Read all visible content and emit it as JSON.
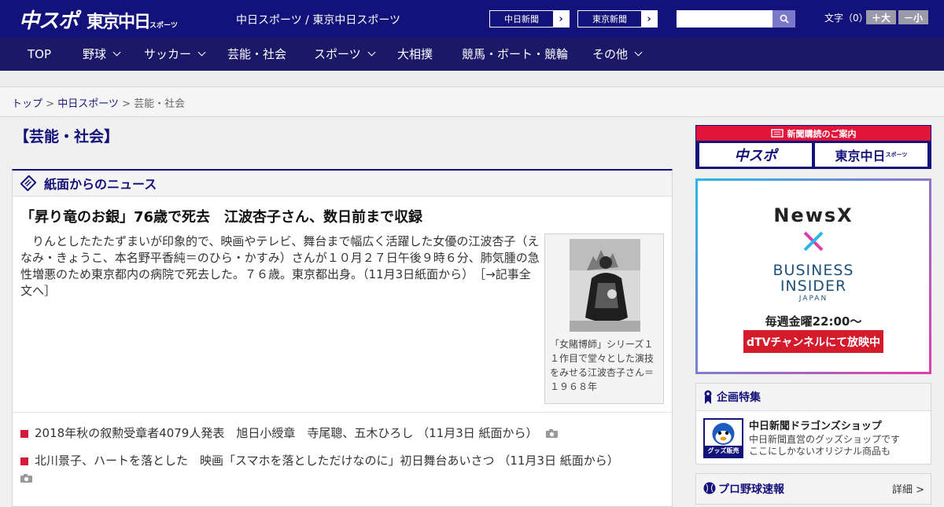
{
  "header": {
    "logo_main": "中スポ",
    "logo_sub": "東京中日",
    "logo_sub_small": "スポーツ",
    "site_links": "中日スポーツ / 東京中日スポーツ",
    "ext_links": [
      "中日新聞",
      "東京新聞"
    ],
    "search_placeholder": "",
    "font_label": "文字（0）",
    "font_larger": "＋大",
    "font_smaller": "－小"
  },
  "nav": {
    "items": [
      {
        "label": "TOP",
        "dropdown": false
      },
      {
        "label": "野球",
        "dropdown": true
      },
      {
        "label": "サッカー",
        "dropdown": true
      },
      {
        "label": "芸能・社会",
        "dropdown": false
      },
      {
        "label": "スポーツ",
        "dropdown": true
      },
      {
        "label": "大相撲",
        "dropdown": false
      },
      {
        "label": "競馬・ボート・競輪",
        "dropdown": false
      },
      {
        "label": "その他",
        "dropdown": true
      }
    ]
  },
  "breadcrumb": {
    "items": [
      "トップ",
      "中日スポーツ",
      "芸能・社会"
    ],
    "separator": " > "
  },
  "page_title": "【芸能・社会】",
  "main": {
    "section_title": "紙面からのニュース",
    "top_story": {
      "headline": "「昇り竜のお銀」76歳で死去　江波杏子さん、数日前まで収録",
      "lead": "　りんとしたたたずまいが印象的で、映画やテレビ、舞台まで幅広く活躍した女優の江波杏子（えなみ・きょうこ、本名野平香純＝のひら・かすみ）さんが１０月２７日午後９時６分、肺気腫の急性増悪のため東京都内の病院で死去した。７６歳。東京都出身。（11月3日紙面から）",
      "more_link": "［→記事全文へ］",
      "photo_caption": "「女賭博師」シリーズ１１作目で堂々とした演技をみせる江波杏子さん＝１９６８年"
    },
    "news_list": [
      {
        "text": "2018年秋の叙勲受章者4079人発表　旭日小綬章　寺尾聰、五木ひろし",
        "date": "（11月3日 紙面から）",
        "has_photo": true
      },
      {
        "text": "北川景子、ハートを落とした　映画「スマホを落としただけなのに」初日舞台あいさつ",
        "date": "（11月3日 紙面から）",
        "has_photo": true
      }
    ]
  },
  "sidebar": {
    "subscribe": {
      "heading": "新聞購読のご案内",
      "logo_left": "中スポ",
      "logo_right": "東京中日",
      "logo_right_small": "スポーツ"
    },
    "ad": {
      "brand": "NewsX",
      "name_line1": "BUSINESS",
      "name_line2": "INSIDER",
      "country": "JAPAN",
      "schedule": "毎週金曜22:00〜",
      "cta": "dTVチャンネルにて放映中"
    },
    "feature": {
      "heading": "企画特集",
      "badge": "グッズ販売中",
      "title": "中日新聞ドラゴンズショップ",
      "desc1": "中日新聞直営のグッズショップです",
      "desc2": "ここにしかないオリジナル商品も"
    },
    "baseball": {
      "heading": "プロ野球速報",
      "detail": "詳細 >"
    }
  },
  "colors": {
    "brand_navy": "#13117a",
    "nav_navy": "#1b1868",
    "accent_red": "#e1143c"
  }
}
